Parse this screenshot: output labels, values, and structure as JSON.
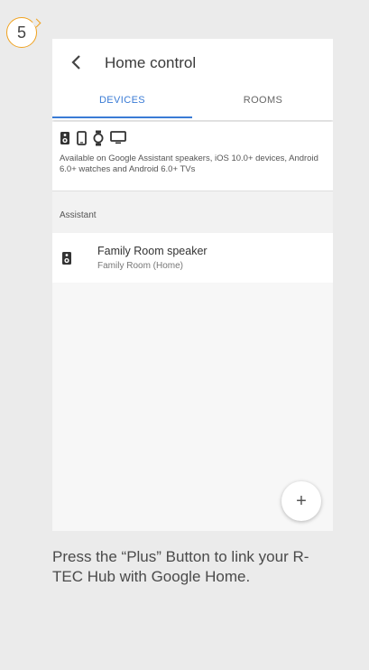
{
  "step": {
    "number": "5",
    "accent_color": "#f0a21f"
  },
  "appbar": {
    "title": "Home control",
    "back_icon": "chevron-left-icon"
  },
  "tabs": [
    {
      "label": "DEVICES",
      "active": true
    },
    {
      "label": "ROOMS",
      "active": false
    }
  ],
  "accent_color": "#3a7bd5",
  "info": {
    "icons": [
      "speaker-icon",
      "phone-icon",
      "watch-icon",
      "tv-icon"
    ],
    "text": "Available on Google Assistant speakers, iOS 10.0+ devices, Android 6.0+ watches and Android 6.0+ TVs"
  },
  "section": {
    "label": "Assistant"
  },
  "devices": [
    {
      "name": "Family Room speaker",
      "location": "Family Room (Home)",
      "icon": "speaker-icon"
    }
  ],
  "fab": {
    "label": "+",
    "icon": "plus-icon"
  },
  "caption": "Press the “Plus” Button to link your R-TEC Hub with Google Home."
}
